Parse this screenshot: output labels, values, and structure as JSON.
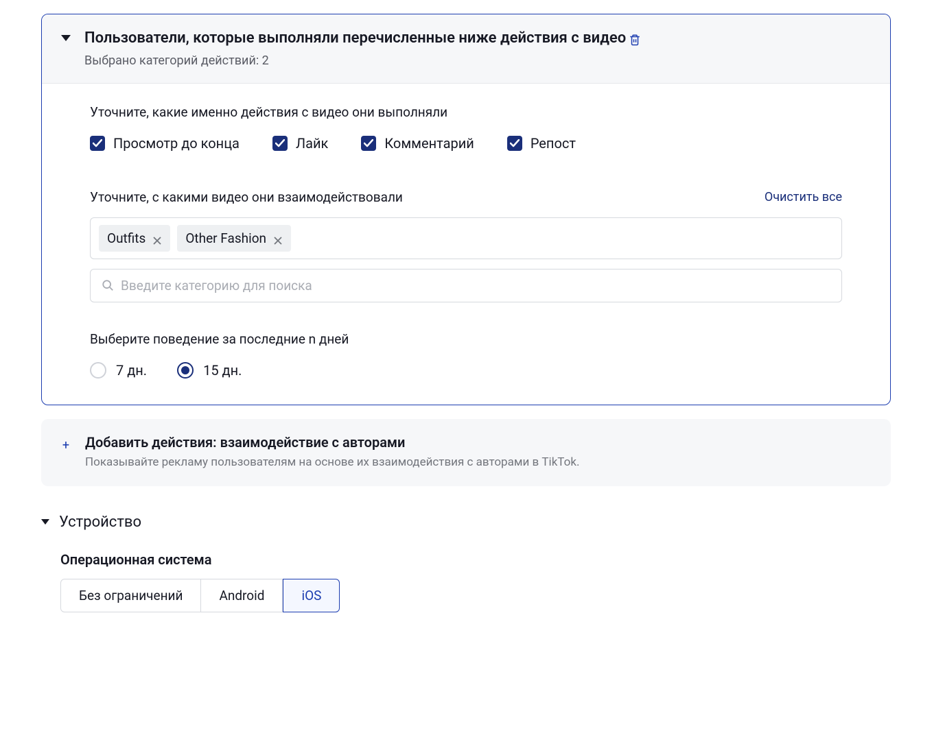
{
  "videoActions": {
    "title": "Пользователи, которые выполняли перечисленные ниже действия с видео",
    "subtitle": "Выбрано категорий действий: 2",
    "refineLabel": "Уточните, какие именно действия с видео они выполняли",
    "checkboxes": [
      {
        "label": "Просмотр до конца"
      },
      {
        "label": "Лайк"
      },
      {
        "label": "Комментарий"
      },
      {
        "label": "Репост"
      }
    ],
    "interactedLabel": "Уточните, с какими видео они взаимодействовали",
    "clearAll": "Очистить все",
    "tags": [
      {
        "label": "Outfits"
      },
      {
        "label": "Other Fashion"
      }
    ],
    "searchPlaceholder": "Введите категорию для поиска",
    "behaviorLabel": "Выберите поведение за последние n дней",
    "radios": [
      {
        "label": "7 дн."
      },
      {
        "label": "15 дн."
      }
    ]
  },
  "addAction": {
    "title": "Добавить действия: взаимодействие с авторами",
    "desc": "Показывайте рекламу пользователям на основе их взаимодействия с авторами в TikTok."
  },
  "device": {
    "title": "Устройство",
    "osLabel": "Операционная система",
    "options": [
      {
        "label": "Без ограничений"
      },
      {
        "label": "Android"
      },
      {
        "label": "iOS"
      }
    ]
  }
}
